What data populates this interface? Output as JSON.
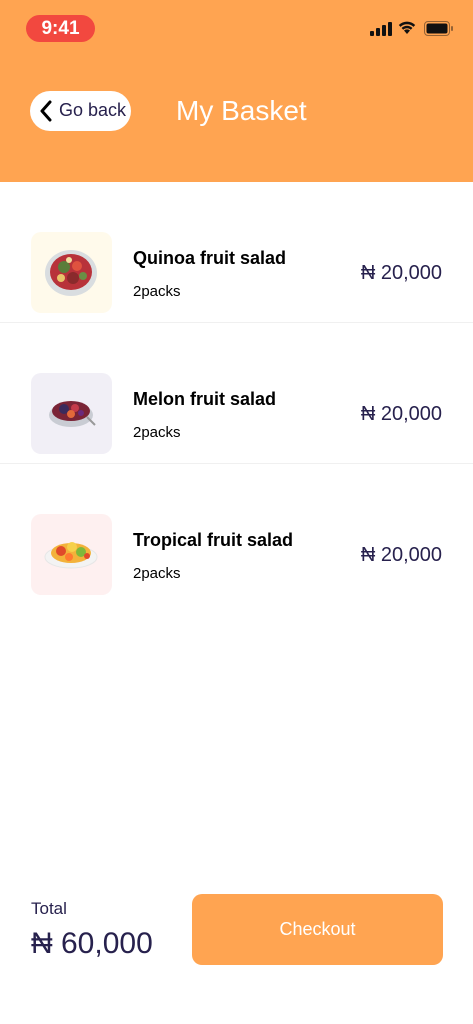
{
  "status_bar": {
    "time": "9:41"
  },
  "header": {
    "back_label": "Go back",
    "title": "My Basket"
  },
  "items": [
    {
      "name": "Quinoa fruit salad",
      "qty": "2packs",
      "price": "₦ 20,000",
      "thumb_bg": "#FFFAEB"
    },
    {
      "name": "Melon fruit salad",
      "qty": "2packs",
      "price": "₦ 20,000",
      "thumb_bg": "#F1EFF6"
    },
    {
      "name": "Tropical fruit salad",
      "qty": "2packs",
      "price": "₦ 20,000",
      "thumb_bg": "#FEF0F0"
    }
  ],
  "footer": {
    "total_label": "Total",
    "total_value": "₦ 60,000",
    "checkout_label": "Checkout"
  },
  "colors": {
    "accent": "#FFA451",
    "text_dark": "#27214D",
    "time_pill": "#F2483F"
  }
}
